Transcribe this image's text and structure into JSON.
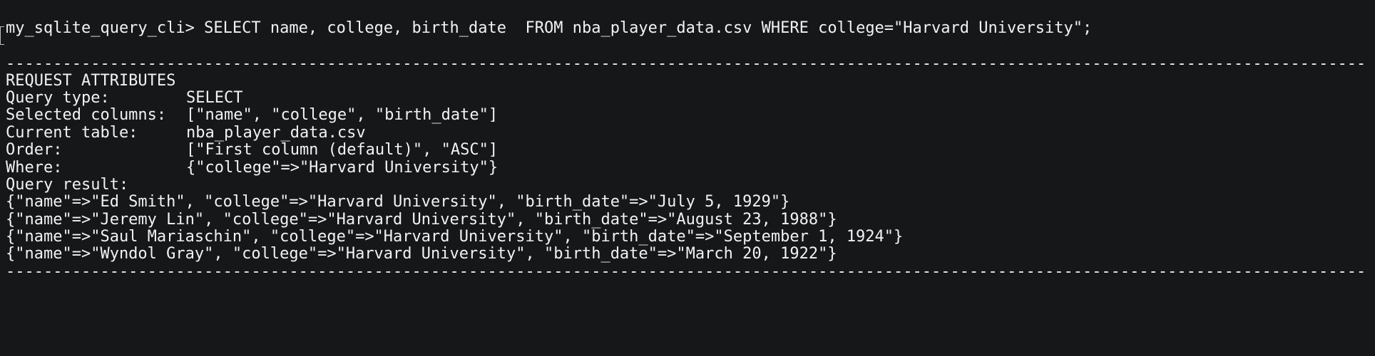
{
  "terminal": {
    "prompt": "my_sqlite_query_cli>",
    "command": "SELECT name, college, birth_date  FROM nba_player_data.csv WHERE college=\"Harvard University\";",
    "divider": "----------------------------------------------------------------------------------------------------------------------------------------------------------------------------------------------------------------------------------------",
    "request_header": "REQUEST ATTRIBUTES",
    "attributes": [
      {
        "label": "Query type:",
        "value": "SELECT"
      },
      {
        "label": "Selected columns:",
        "value": "[\"name\", \"college\", \"birth_date\"]"
      },
      {
        "label": "Current table:",
        "value": "nba_player_data.csv"
      },
      {
        "label": "Order:",
        "value": "[\"First column (default)\", \"ASC\"]"
      },
      {
        "label": "Where:",
        "value": "{\"college\"=>\"Harvard University\"}"
      }
    ],
    "result_header": "Query result:",
    "results": [
      "{\"name\"=>\"Ed Smith\", \"college\"=>\"Harvard University\", \"birth_date\"=>\"July 5, 1929\"}",
      "{\"name\"=>\"Jeremy Lin\", \"college\"=>\"Harvard University\", \"birth_date\"=>\"August 23, 1988\"}",
      "{\"name\"=>\"Saul Mariaschin\", \"college\"=>\"Harvard University\", \"birth_date\"=>\"September 1, 1924\"}",
      "{\"name\"=>\"Wyndol Gray\", \"college\"=>\"Harvard University\", \"birth_date\"=>\"March 20, 1922\"}"
    ]
  },
  "colors": {
    "background": "#161719",
    "foreground": "#f2f2f2"
  }
}
